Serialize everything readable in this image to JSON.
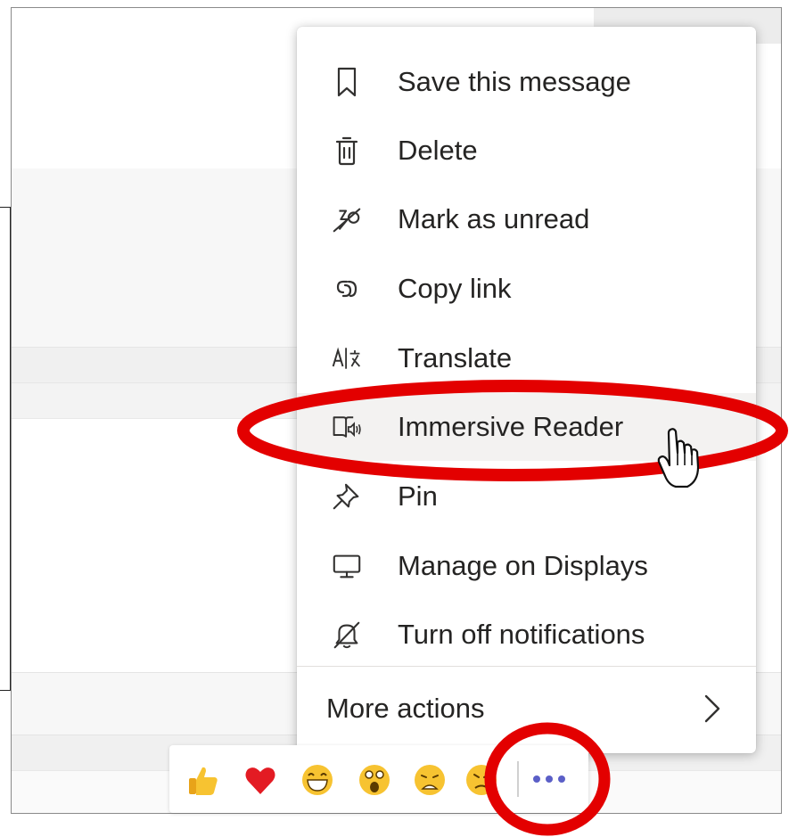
{
  "menu": {
    "items": [
      {
        "label": "Save this message",
        "icon": "bookmark-icon"
      },
      {
        "label": "Delete",
        "icon": "trash-icon"
      },
      {
        "label": "Mark as unread",
        "icon": "mark-unread-icon"
      },
      {
        "label": "Copy link",
        "icon": "link-icon"
      },
      {
        "label": "Translate",
        "icon": "translate-icon"
      },
      {
        "label": "Immersive Reader",
        "icon": "immersive-reader-icon"
      },
      {
        "label": "Pin",
        "icon": "pin-icon"
      },
      {
        "label": "Manage on Displays",
        "icon": "display-icon"
      },
      {
        "label": "Turn off notifications",
        "icon": "bell-off-icon"
      }
    ],
    "more_actions": "More actions"
  },
  "reactions": [
    "like",
    "heart",
    "laugh",
    "surprised",
    "sad",
    "angry"
  ],
  "colors": {
    "accent": "#5b5fc7",
    "annotation": "#e30000",
    "hover": "#f3f2f1"
  }
}
